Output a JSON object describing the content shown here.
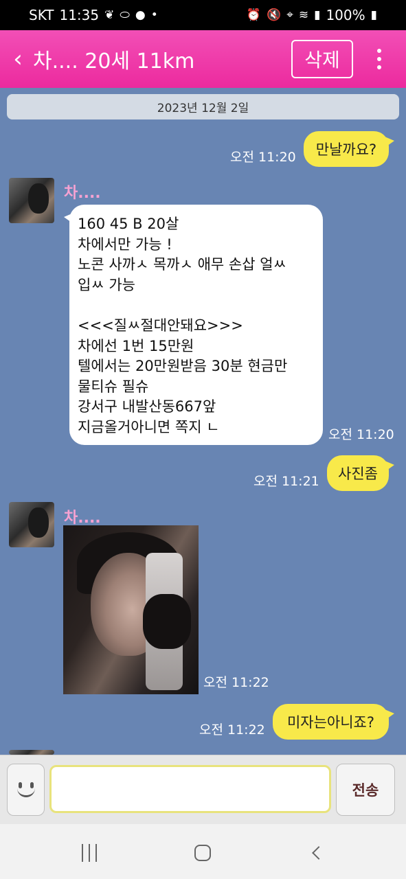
{
  "status_bar": {
    "carrier": "SKT",
    "time": "11:35",
    "battery": "100%",
    "left_icons": [
      "leaf-icon",
      "pill-icon",
      "talk-icon",
      "dot-icon"
    ],
    "right_icons": [
      "alarm-icon",
      "mute-icon",
      "location-icon",
      "wifi-icon",
      "signal-icon",
      "battery-icon"
    ]
  },
  "header": {
    "back_label": "<",
    "title": "차.... 20세 11km",
    "delete_label": "삭제",
    "more_label": "more-icon",
    "color": "#ec2a9e"
  },
  "date_divider": "2023년 12월 2일",
  "messages": [
    {
      "side": "me",
      "time": "오전 11:20",
      "text": "만날까요?"
    },
    {
      "side": "other",
      "sender": "차....",
      "time": "오전 11:20",
      "text": "160 45 B 20살\n차에서만 가능 !\n노콘 사까ㅅ 목까ㅅ 애무 손삽 얼ㅆ\n입ㅆ 가능\n\n<<<질ㅆ절대안돼요>>>\n차에선 1번 15만원\n텔에서는 20만원받음 30분 현금만\n물티슈 필슈\n강서구 내발산동667앞\n지금올거아니면 쪽지 ㄴ"
    },
    {
      "side": "me",
      "time": "오전 11:21",
      "text": "사진좀"
    },
    {
      "side": "other",
      "sender": "차....",
      "time": "오전 11:22",
      "type": "photo"
    },
    {
      "side": "me",
      "time": "오전 11:22",
      "text": "미자는아니죠?"
    }
  ],
  "input": {
    "value": "",
    "placeholder": "",
    "send_label": "전송",
    "emoji_icon": "smile-icon"
  },
  "nav": {
    "icons": [
      "recent-apps-icon",
      "home-icon",
      "back-icon"
    ]
  },
  "colors": {
    "chat_bg": "#6885b3",
    "my_bubble": "#f8e94a",
    "other_bubble": "#ffffff",
    "sender_name": "#f7a2d2"
  }
}
